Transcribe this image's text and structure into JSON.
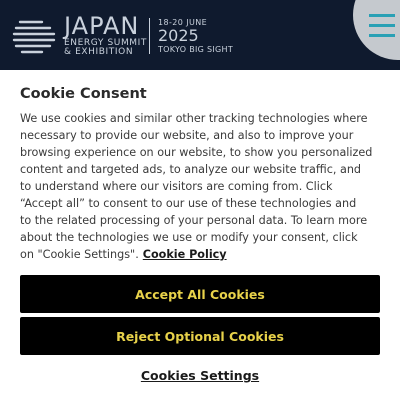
{
  "header": {
    "brand": {
      "main": "JAPAN",
      "sub_line1": "ENERGY SUMMIT",
      "sub_line2": "& EXHIBITION"
    },
    "event": {
      "dates": "18-20 JUNE",
      "year": "2025",
      "venue": "TOKYO BIG SIGHT"
    },
    "menu_icon": "hamburger-menu-icon",
    "colors": {
      "background": "#0f1a2e",
      "menu_circle": "#c5c9ce",
      "menu_icon": "#2aa0b5"
    }
  },
  "cookie": {
    "title": "Cookie Consent",
    "body_lines": [
      "We use cookies and similar other tracking technologies where",
      "necessary to provide our website, and also to improve your",
      "browsing experience on our website, to show you personalized",
      "content and targeted ads, to analyze our website traffic, and",
      "to understand where our visitors are coming from. Click",
      "“Accept all” to consent to our use of these technologies and",
      "to the related processing of your personal data. To learn more",
      "about the technologies we use or modify your consent, click",
      "on \"Cookie Settings\"."
    ],
    "policy_link": "Cookie Policy",
    "accept_label": "Accept All Cookies",
    "reject_label": "Reject Optional Cookies",
    "settings_label": "Cookies Settings",
    "colors": {
      "button_bg": "#000000",
      "button_text": "#e8d24a"
    }
  }
}
